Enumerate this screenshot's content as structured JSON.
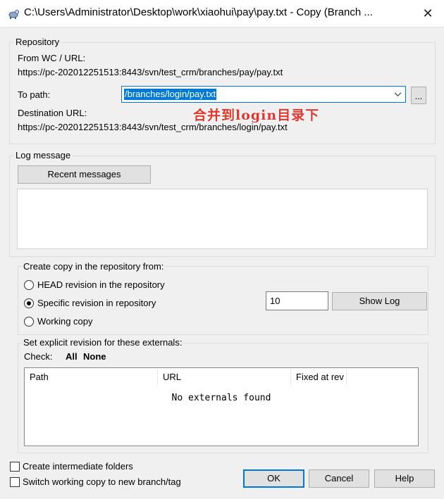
{
  "window": {
    "title": "C:\\Users\\Administrator\\Desktop\\work\\xiaohui\\pay\\pay.txt - Copy (Branch ...",
    "close_glyph": "✕"
  },
  "repository": {
    "group_title": "Repository",
    "from_label": "From WC / URL:",
    "from_url": "https://pc-202012251513:8443/svn/test_crm/branches/pay/pay.txt",
    "to_path_label": "To path:",
    "to_path_value": "/branches/login/pay.txt",
    "browse_label": "...",
    "annotation": "合并到login目录下",
    "dest_label": "Destination URL:",
    "dest_url": "https://pc-202012251513:8443/svn/test_crm/branches/login/pay.txt"
  },
  "log": {
    "group_title": "Log message",
    "recent_button": "Recent messages",
    "message_text": ""
  },
  "copy_from": {
    "group_title": "Create copy in the repository from:",
    "options": [
      {
        "label": "HEAD revision in the repository",
        "selected": false
      },
      {
        "label": "Specific revision in repository",
        "selected": true
      },
      {
        "label": "Working copy",
        "selected": false
      }
    ],
    "revision_value": "10",
    "show_log_button": "Show Log"
  },
  "externals": {
    "group_title": "Set explicit revision for these externals:",
    "check_label": "Check:",
    "all_label": "All",
    "none_label": "None",
    "columns": [
      "Path",
      "URL",
      "Fixed at rev"
    ],
    "empty_text": "No externals found"
  },
  "footer": {
    "create_folders_label": "Create intermediate folders",
    "create_folders_checked": false,
    "switch_label": "Switch working copy to new branch/tag",
    "switch_checked": false,
    "ok_button": "OK",
    "cancel_button": "Cancel",
    "help_button": "Help"
  },
  "colors": {
    "selection": "#0078d7",
    "annotation": "#e8332a",
    "default_button_border": "#0078d7"
  }
}
